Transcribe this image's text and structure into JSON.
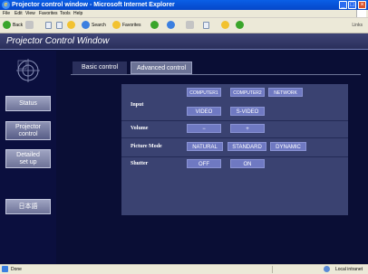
{
  "window": {
    "title": "Projector control window - Microsoft Internet Explorer",
    "minimize": "_",
    "maximize": "□",
    "close": "×"
  },
  "menu": [
    "File",
    "Edit",
    "View",
    "Favorites",
    "Tools",
    "Help"
  ],
  "toolbar": {
    "back": "Back",
    "search": "Search",
    "favorites": "Favorites",
    "links": "Links"
  },
  "app": {
    "title": "Projector Control Window",
    "sidebar": {
      "status": "Status",
      "projector_control_line1": "Projector",
      "projector_control_line2": "control",
      "detailed_setup_line1": "Detailed",
      "detailed_setup_line2": "set up",
      "language": "日本語"
    },
    "tabs": {
      "basic": "Basic control",
      "advanced": "Advanced control"
    },
    "controls": {
      "input_label": "Input",
      "input_options": [
        "COMPUTER1",
        "COMPUTER2",
        "NETWORK",
        "VIDEO",
        "S-VIDEO"
      ],
      "volume_label": "Volume",
      "volume_down": "−",
      "volume_up": "+",
      "picture_mode_label": "Picture Mode",
      "picture_modes": [
        "NATURAL",
        "STANDARD",
        "DYNAMIC"
      ],
      "shutter_label": "Shutter",
      "shutter_off": "OFF",
      "shutter_on": "ON"
    }
  },
  "statusbar": {
    "left": "Done",
    "zone": "Local intranet"
  }
}
